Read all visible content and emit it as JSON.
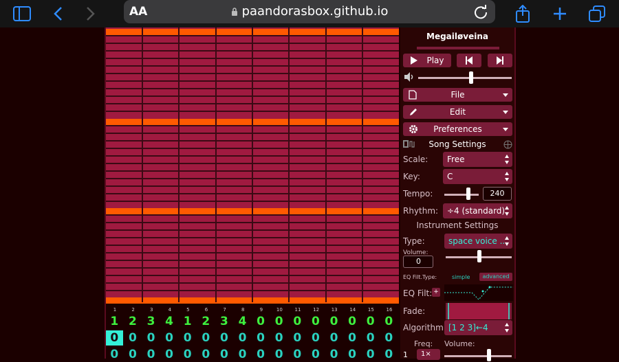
{
  "browser": {
    "aa_label": "AA",
    "url": "paandorasbox.github.io"
  },
  "song": {
    "title": "Megailøveina"
  },
  "menu": {
    "play": "Play",
    "file": "File",
    "edit": "Edit",
    "preferences": "Preferences"
  },
  "song_settings": {
    "header": "Song Settings",
    "scale_label": "Scale:",
    "scale_value": "Free",
    "key_label": "Key:",
    "key_value": "C",
    "tempo_label": "Tempo:",
    "tempo_value": "240",
    "rhythm_label": "Rhythm:",
    "rhythm_value": "÷4 (standard)"
  },
  "instrument": {
    "header": "Instrument Settings",
    "type_label": "Type:",
    "type_value": "space voice ...",
    "volume_label": "Volume:",
    "volume_value": "0",
    "eq_type_label": "EQ Filt.Type:",
    "eq_simple": "simple",
    "eq_advanced": "advanced",
    "eq_filt_label": "EQ Filt:",
    "eq_add": "+",
    "fade_label": "Fade:",
    "algorithm_label": "Algorithm:",
    "algorithm_value": "[1 2 3]←4",
    "freq_label": "Freq:",
    "op_volume_label": "Volume:",
    "freq_row_a": "1",
    "freq_row_b": "1×"
  },
  "bar_numbers": [
    "1",
    "2",
    "3",
    "4",
    "5",
    "6",
    "7",
    "8",
    "9",
    "10",
    "11",
    "12",
    "13",
    "14",
    "15",
    "16"
  ],
  "channels": [
    [
      "1",
      "2",
      "3",
      "4",
      "1",
      "2",
      "3",
      "4",
      "0",
      "0",
      "0",
      "0",
      "0",
      "0",
      "0",
      "0"
    ],
    [
      "0",
      "0",
      "0",
      "0",
      "0",
      "0",
      "0",
      "0",
      "0",
      "0",
      "0",
      "0",
      "0",
      "0",
      "0",
      "0"
    ],
    [
      "0",
      "0",
      "0",
      "0",
      "0",
      "0",
      "0",
      "0",
      "0",
      "0",
      "0",
      "0",
      "0",
      "0",
      "0",
      "0"
    ]
  ],
  "colors": {
    "pattern_bg": "#a01a40",
    "bar_accent": "#ff5a00",
    "channel_pitch": "#3ef03e",
    "channel_noise": "#2ad2c0"
  }
}
